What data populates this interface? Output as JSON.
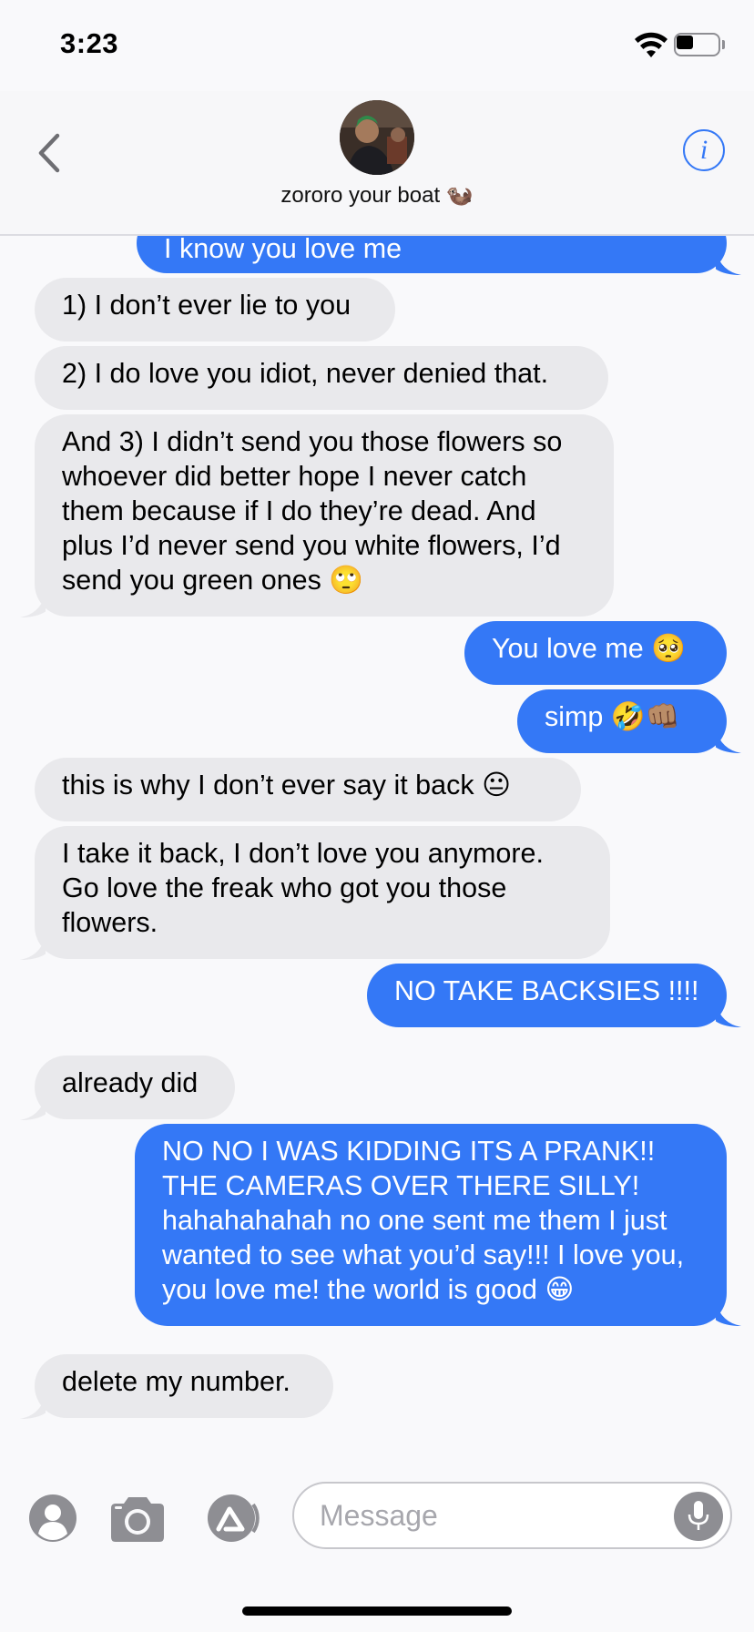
{
  "status_bar": {
    "time": "3:23",
    "battery_level": 0.4,
    "icons": [
      "wifi-icon",
      "battery-icon"
    ]
  },
  "header": {
    "contact_name": "zororo your boat 🦦",
    "back_icon": "chevron-left-icon",
    "info_icon": "info-icon",
    "info_symbol": "i"
  },
  "messages": [
    {
      "direction": "out",
      "text": "I know you love me"
    },
    {
      "direction": "in",
      "text": "1) I don’t ever lie to you"
    },
    {
      "direction": "in",
      "text": "2) I do love you idiot, never denied that."
    },
    {
      "direction": "in",
      "text": "And 3) I didn’t send you those flowers so whoever did better hope I never catch them because if I do they’re dead. And plus I’d never send you white flowers, I’d send you green ones 🙄"
    },
    {
      "direction": "out",
      "text": "You love me 🥺"
    },
    {
      "direction": "out",
      "text": "simp 🤣👊🏽"
    },
    {
      "direction": "in",
      "text": "this is why I don’t ever say it back 😐"
    },
    {
      "direction": "in",
      "text": "I take it back, I don’t love you anymore. Go love the freak who got you those flowers."
    },
    {
      "direction": "out",
      "text": "NO TAKE BACKSIES !!!!"
    },
    {
      "direction": "in",
      "text": "already did"
    },
    {
      "direction": "out",
      "text": "NO NO I WAS KIDDING ITS A PRANK!! THE CAMERAS OVER THERE SILLY! hahahahahah no one sent me them I just wanted to see what you’d say!!! I love you, you love me! the world is good 😁"
    },
    {
      "direction": "in",
      "text": "delete my number."
    }
  ],
  "composer": {
    "placeholder": "Message",
    "icons": [
      "contact-icon",
      "camera-icon",
      "app-store-icon",
      "microphone-icon"
    ]
  },
  "colors": {
    "outgoing_bubble": "#3478f6",
    "incoming_bubble": "#e9e9ec",
    "accent": "#3478f6"
  }
}
